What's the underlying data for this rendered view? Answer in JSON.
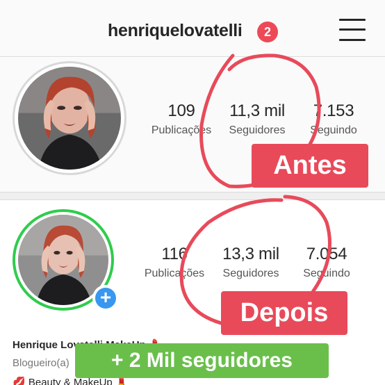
{
  "header": {
    "username": "henriquelovatelli",
    "notification_count": "2",
    "menu_icon": "hamburger-menu-icon"
  },
  "before": {
    "stats": [
      {
        "value": "109",
        "label": "Publicações"
      },
      {
        "value": "11,3 mil",
        "label": "Seguidores"
      },
      {
        "value": "7.153",
        "label": "Seguindo"
      }
    ],
    "tag": "Antes"
  },
  "after": {
    "stats": [
      {
        "value": "116",
        "label": "Publicações"
      },
      {
        "value": "13,3 mil",
        "label": "Seguidores"
      },
      {
        "value": "7.054",
        "label": "Seguindo"
      }
    ],
    "tag": "Depois"
  },
  "bio": {
    "name": "Henrique Lovatelli MakeUp 💄",
    "category": "Blogueiro(a)",
    "line3": "💋 Beauty & MakeUp 💄"
  },
  "gain_tag": "+ 2 Mil seguidores",
  "colors": {
    "accent_red": "#e84a5a",
    "accent_green": "#6abf4b",
    "story_ring_green": "#2fcc4c",
    "add_blue": "#3897f0",
    "badge_red": "#ed4956"
  }
}
